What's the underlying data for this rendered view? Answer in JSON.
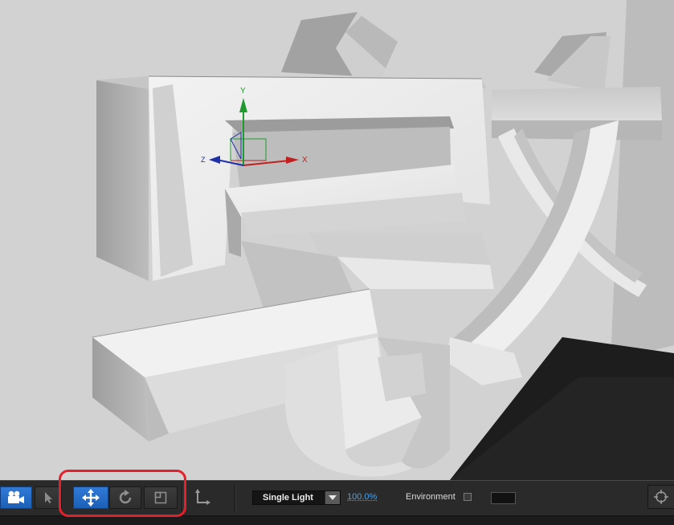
{
  "toolbar": {
    "light_mode": "Single Light",
    "zoom": "100.0%",
    "environment_label": "Environment"
  },
  "gizmo": {
    "x_label": "X",
    "y_label": "Y",
    "z_label": "Z"
  },
  "icons": {
    "camera": "camera-icon",
    "select": "select-arrow-icon",
    "move": "move-icon",
    "rotate": "rotate-icon",
    "scale": "scale-icon",
    "axis": "axis-icon",
    "dropdown": "chevron-down-icon",
    "target": "target-icon"
  },
  "colors": {
    "active_tool": "#1d5fb6",
    "highlight": "#e4202a",
    "link": "#4aa0e8",
    "x_axis": "#c0201f",
    "y_axis": "#1f9a2e",
    "z_axis": "#1f2fa8"
  }
}
